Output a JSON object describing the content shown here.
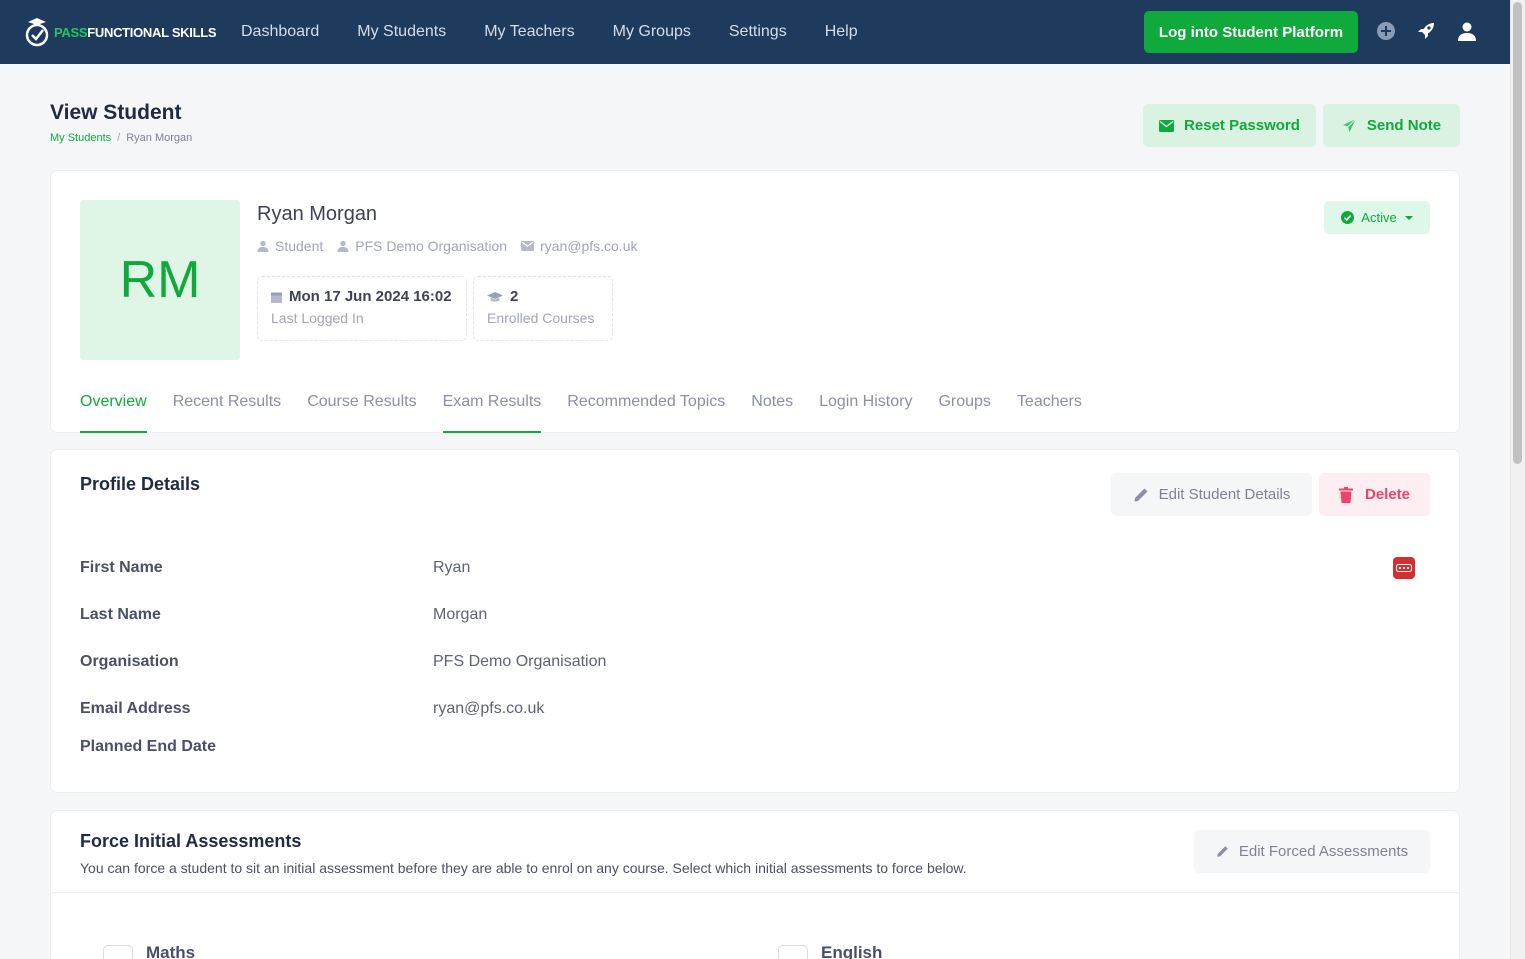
{
  "brand": {
    "pass": "PASS",
    "rest": "FUNCTIONAL SKILLS"
  },
  "nav": [
    "Dashboard",
    "My Students",
    "My Teachers",
    "My Groups",
    "Settings",
    "Help"
  ],
  "topbar": {
    "login_button": "Log into Student Platform"
  },
  "header": {
    "title": "View Student",
    "breadcrumb": [
      "My Students",
      "Ryan Morgan"
    ],
    "reset_password": "Reset Password",
    "send_note": "Send Note"
  },
  "student": {
    "initials": "RM",
    "name": "Ryan Morgan",
    "role": "Student",
    "organisation": "PFS Demo Organisation",
    "email": "ryan@pfs.co.uk",
    "last_logged_in": "Mon 17 Jun 2024 16:02",
    "last_logged_in_label": "Last Logged In",
    "enrolled_courses": "2",
    "enrolled_courses_label": "Enrolled Courses",
    "status": "Active"
  },
  "tabs": [
    "Overview",
    "Recent Results",
    "Course Results",
    "Exam Results",
    "Recommended Topics",
    "Notes",
    "Login History",
    "Groups",
    "Teachers"
  ],
  "profile": {
    "title": "Profile Details",
    "edit_button": "Edit Student Details",
    "delete_button": "Delete",
    "rows": [
      {
        "label": "First Name",
        "value": "Ryan"
      },
      {
        "label": "Last Name",
        "value": "Morgan"
      },
      {
        "label": "Organisation",
        "value": "PFS Demo Organisation"
      },
      {
        "label": "Email Address",
        "value": "ryan@pfs.co.uk"
      },
      {
        "label": "Planned End Date",
        "value": ""
      }
    ]
  },
  "assessments": {
    "title": "Force Initial Assessments",
    "description": "You can force a student to sit an initial assessment before they are able to enrol on any course. Select which initial assessments to force below.",
    "edit_button": "Edit Forced Assessments",
    "options": [
      "Maths",
      "English"
    ]
  },
  "colors": {
    "topbar": "#1e3a5c",
    "accent": "#0fa93c",
    "danger": "#f1416c"
  }
}
